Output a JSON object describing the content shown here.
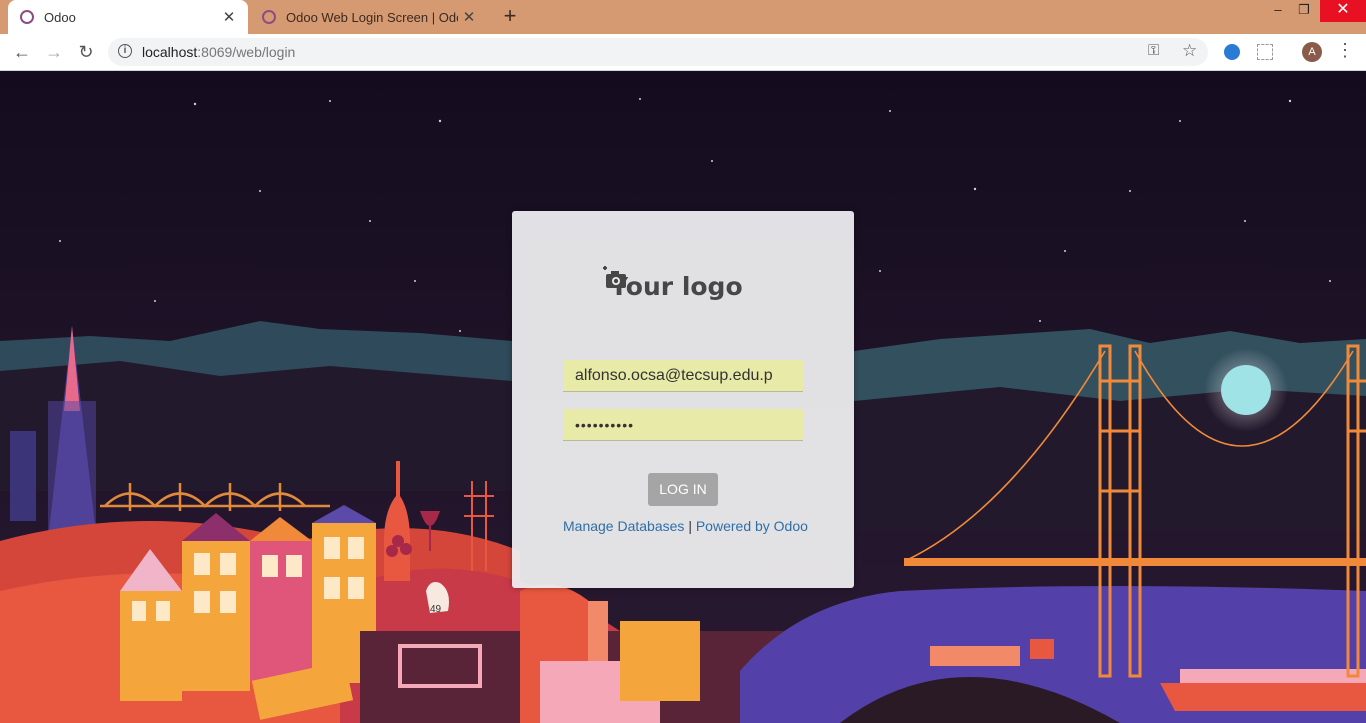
{
  "browser": {
    "tabs": [
      {
        "title": "Odoo",
        "active": true
      },
      {
        "title": "Odoo Web Login Screen | Odoo",
        "active": false
      }
    ],
    "url_host": "localhost",
    "url_rest": ":8069/web/login",
    "avatar_letter": "A",
    "icons": {
      "back": "back-arrow-icon",
      "forward": "forward-arrow-icon",
      "reload": "reload-icon",
      "info": "site-info-icon",
      "key": "key-icon",
      "star": "bookmark-star-icon",
      "menu": "kebab-menu-icon"
    },
    "accent_color": "#d69a72"
  },
  "login": {
    "logo_text": "Your logo",
    "login_value": "alfonso.ocsa@tecsup.edu.p",
    "password_value": "••••••••••",
    "submit_label": "LOG IN",
    "manage_databases": "Manage Databases",
    "separator": "|",
    "powered_by": "Powered by Odoo",
    "field_color": "#e8eaa8"
  },
  "background": {
    "badge_number": "49"
  }
}
